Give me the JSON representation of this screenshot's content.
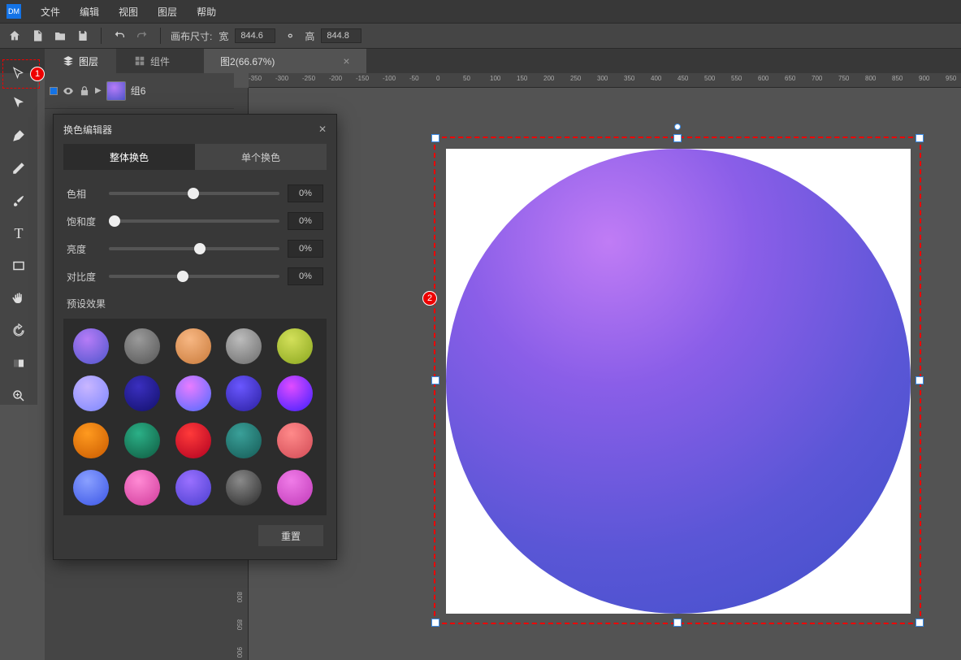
{
  "menu": {
    "items": [
      "文件",
      "编辑",
      "视图",
      "图层",
      "帮助"
    ]
  },
  "toolbar": {
    "canvas_label": "画布尺寸:",
    "width_label": "宽",
    "width_value": "844.6",
    "height_label": "高",
    "height_value": "844.8"
  },
  "tabs": {
    "layers": "图层",
    "components": "组件",
    "doc": "图2(66.67%)"
  },
  "layer": {
    "name": "组6"
  },
  "color_editor": {
    "title": "换色编辑器",
    "tab_global": "整体换色",
    "tab_single": "单个换色",
    "sliders": [
      {
        "label": "色相",
        "value": "0%",
        "pos": 46
      },
      {
        "label": "饱和度",
        "value": "0%",
        "pos": 0
      },
      {
        "label": "亮度",
        "value": "0%",
        "pos": 50
      },
      {
        "label": "对比度",
        "value": "0%",
        "pos": 40
      }
    ],
    "presets_label": "预设效果",
    "presets": [
      "radial-gradient(circle at 40% 30%,#b67cf7,#4d55cc)",
      "radial-gradient(circle at 40% 30%,#9a9a9a,#555)",
      "radial-gradient(circle at 40% 30%,#f7b783,#c97a3a)",
      "radial-gradient(circle at 40% 30%,#bcbcbc,#6b6b6b)",
      "radial-gradient(circle at 40% 30%,#d3e05a,#8aa61e)",
      "radial-gradient(circle at 40% 30%,#c9b6ff,#7b86ff)",
      "radial-gradient(circle at 40% 30%,#3a2fbf,#12106b)",
      "radial-gradient(circle at 40% 30%,#e97cff,#4a6bff)",
      "radial-gradient(circle at 40% 30%,#6a57ff,#2a1fa0)",
      "radial-gradient(circle at 40% 30%,#e14cff,#3a1fff)",
      "radial-gradient(circle at 40% 30%,#ff9a1f,#c95a00)",
      "radial-gradient(circle at 40% 30%,#2bb087,#0f5a40)",
      "radial-gradient(circle at 40% 30%,#ff3a3a,#b00020)",
      "radial-gradient(circle at 40% 30%,#3aa099,#155a55)",
      "radial-gradient(circle at 40% 30%,#ff8a8a,#d14a55)",
      "radial-gradient(circle at 40% 30%,#8aa0ff,#3a55e6)",
      "radial-gradient(circle at 40% 30%,#ff8ad4,#d03a9a)",
      "radial-gradient(circle at 40% 30%,#9a70ff,#4a3fd0)",
      "radial-gradient(circle at 40% 30%,#8a8a8a,#2a2a2a)",
      "radial-gradient(circle at 40% 30%,#f07ce8,#c03ab8)"
    ],
    "reset": "重置"
  },
  "markers": {
    "m1": "1",
    "m2": "2"
  },
  "ruler_h": [
    "-350",
    "-300",
    "-250",
    "-200",
    "-150",
    "-100",
    "-50",
    "0",
    "50",
    "100",
    "150",
    "200",
    "250",
    "300",
    "350",
    "400",
    "450",
    "500",
    "550",
    "600",
    "650",
    "700",
    "750",
    "800",
    "850",
    "900",
    "950"
  ],
  "ruler_v": [
    "800",
    "850",
    "900"
  ]
}
